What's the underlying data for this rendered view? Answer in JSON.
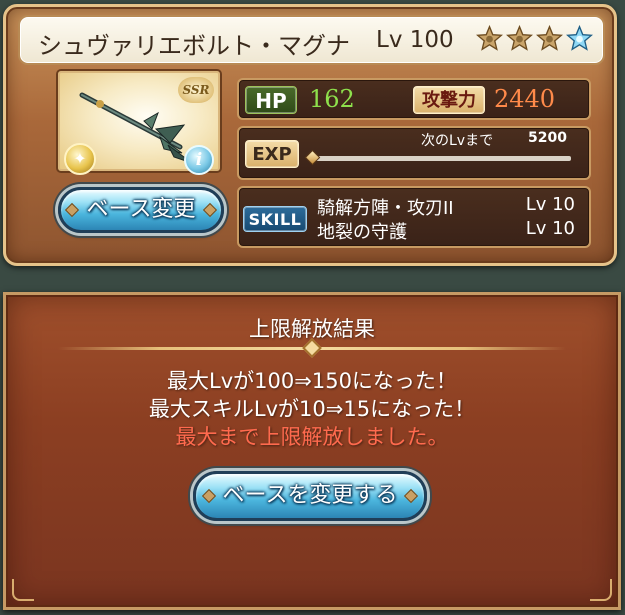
{
  "weapon": {
    "name": "シュヴァリエボルト・マグナ",
    "level": "Lv 100",
    "rarity": "SSR",
    "stars_filled": 3,
    "stars_total": 4,
    "element_icon": "light-element-icon",
    "info_icon": "info-icon"
  },
  "stats": {
    "hp_label": "HP",
    "hp_value": "162",
    "atk_label": "攻撃力",
    "atk_value": "2440",
    "exp_label": "EXP",
    "next_level_label": "次のLvまで",
    "next_level_value": "5200",
    "exp_progress": 0.0
  },
  "skills": {
    "label": "SKILL",
    "items": [
      {
        "name": "騎解方陣・攻刃II",
        "level": "Lv 10"
      },
      {
        "name": "地裂の守護",
        "level": "Lv 10"
      }
    ]
  },
  "buttons": {
    "base_change": "ベース変更",
    "change_base": "ベースを変更する"
  },
  "result": {
    "title": "上限解放結果",
    "line1": "最大Lvが100⇒150になった！",
    "line2": "最大スキルLvが10⇒15になった！",
    "line3": "最大まで上限解放しました。"
  },
  "colors": {
    "hp_value": "#8ee04c",
    "atk_value": "#ff8a4a",
    "highlight_text": "#ff6a4e",
    "button_blue": "#4bb5dd",
    "panel_brown": "#8c3f22"
  }
}
